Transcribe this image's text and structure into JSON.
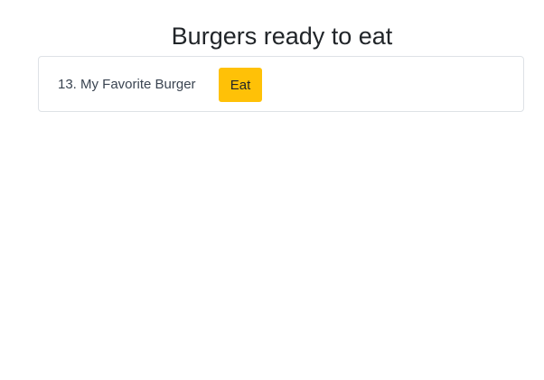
{
  "title": "Burgers ready to eat",
  "burgers": [
    {
      "label": "13. My Favorite Burger",
      "button": "Eat"
    }
  ],
  "colors": {
    "button": "#ffc107"
  }
}
